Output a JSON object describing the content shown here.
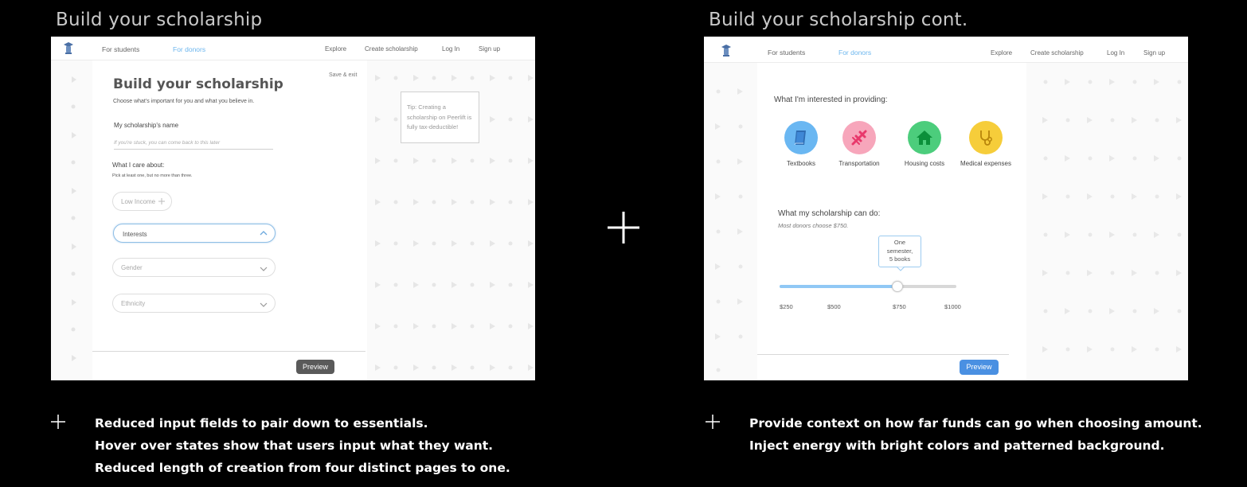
{
  "left": {
    "section_title": "Build your scholarship",
    "nav": {
      "for_students": "For students",
      "for_donors": "For donors",
      "explore": "Explore",
      "create": "Create scholarship",
      "login": "Log In",
      "signup": "Sign up"
    },
    "save_exit": "Save & exit",
    "heading": "Build your scholarship",
    "subheading": "Choose what's important for you and what you believe in.",
    "name_label": "My scholarship's name",
    "name_placeholder": "If you're stuck, you can come back to this later",
    "care_label": "What I care about:",
    "care_hint": "Pick at least one, but no more than three.",
    "pill_low_income": "Low Income",
    "pill_interests": "Interests",
    "pill_gender": "Gender",
    "pill_ethnicity": "Ethnicity",
    "tip": "Tip:  Creating a scholarship on Peerlift is fully tax-deductible!",
    "preview": "Preview",
    "captions": [
      "Reduced input fields to pair down to essentials.",
      "Hover over states show that users input what they want.",
      "Reduced length of creation from four distinct pages to one."
    ]
  },
  "right": {
    "section_title": "Build your scholarship cont.",
    "nav": {
      "for_students": "For students",
      "for_donors": "For donors",
      "explore": "Explore",
      "create": "Create scholarship",
      "login": "Log In",
      "signup": "Sign up"
    },
    "providing_label": "What I'm interested in providing:",
    "icons": [
      {
        "label": "Textbooks",
        "icon": "book-icon",
        "color": "#6ab7f2"
      },
      {
        "label": "Transportation",
        "icon": "airplane-icon",
        "color": "#f7a6bb"
      },
      {
        "label": "Housing costs",
        "icon": "house-icon",
        "color": "#4ccd7c"
      },
      {
        "label": "Medical expenses",
        "icon": "stethoscope-icon",
        "color": "#f6cd3a"
      }
    ],
    "can_do_label": "What my scholarship can do:",
    "can_do_hint": "Most donors choose $750.",
    "tooltip": [
      "One",
      "semester,",
      "5 books"
    ],
    "slider": {
      "min": 250,
      "max": 1000,
      "value": 750,
      "ticks": [
        "$250",
        "$500",
        "$750",
        "$1000"
      ]
    },
    "preview": "Preview",
    "captions": [
      "Provide context on how far funds can go when choosing amount.",
      "Inject energy with bright colors and patterned background."
    ]
  },
  "colors": {
    "accent_blue": "#6cb6ee",
    "preview_dark": "#5a5a5a",
    "preview_blue": "#4a90e2",
    "slider_fill": "#90c8f5"
  }
}
